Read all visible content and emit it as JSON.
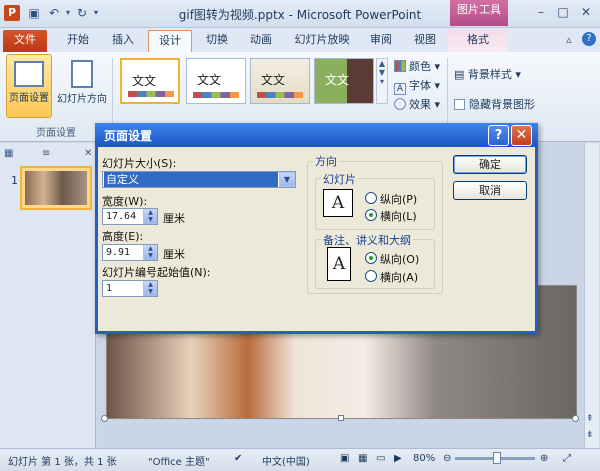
{
  "window": {
    "title": "gif图转为视频.pptx - Microsoft PowerPoint",
    "context_tab_group": "图片工具",
    "app_icon": "P"
  },
  "ribbon": {
    "tabs": [
      "文件",
      "开始",
      "插入",
      "设计",
      "切换",
      "动画",
      "幻灯片放映",
      "审阅",
      "视图",
      "格式"
    ],
    "active_tab": "设计",
    "page_setup_group": {
      "label": "页面设置",
      "page_setup_button": "页面设置",
      "orientation_button": "幻灯片方向"
    },
    "themes": [
      "文文",
      "文文",
      "文文",
      "文文"
    ],
    "theme_options": [
      "颜色",
      "字体",
      "效果"
    ],
    "background": {
      "style_label": "背景样式",
      "hide_label": "隐藏背景图形"
    }
  },
  "slides_pane": {
    "slide_number": "1"
  },
  "dialog": {
    "title": "页面设置",
    "size_label": "幻灯片大小(S):",
    "size_value": "自定义",
    "width_label": "宽度(W):",
    "width_value": "17.64",
    "width_unit": "厘米",
    "height_label": "高度(E):",
    "height_value": "9.91",
    "height_unit": "厘米",
    "number_from_label": "幻灯片编号起始值(N):",
    "number_from_value": "1",
    "orientation_label": "方向",
    "slides_group": "幻灯片",
    "slides_portrait": "纵向(P)",
    "slides_landscape": "横向(L)",
    "notes_group": "备注、讲义和大纲",
    "notes_portrait": "纵向(O)",
    "notes_landscape": "横向(A)",
    "ok": "确定",
    "cancel": "取消"
  },
  "statusbar": {
    "slide_info": "幻灯片 第 1 张，共 1 张",
    "theme": "\"Office 主题\"",
    "language": "中文(中国)",
    "zoom": "80%"
  },
  "colors": {
    "dialog_title": "#1c56c8",
    "file_tab": "#c8461a",
    "context_tab": "#b24d88"
  }
}
